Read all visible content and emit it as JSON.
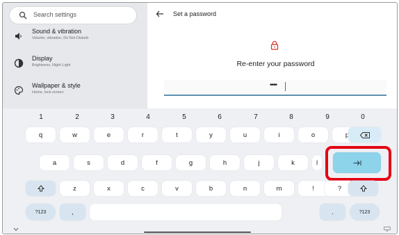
{
  "search": {
    "placeholder": "Search settings"
  },
  "settings_items": [
    {
      "title": "Sound & vibration",
      "subtitle": "Volume, vibration, Do Not Disturb",
      "icon": "speaker-icon"
    },
    {
      "title": "Display",
      "subtitle": "Brightness, Night Light",
      "icon": "brightness-icon"
    },
    {
      "title": "Wallpaper & style",
      "subtitle": "Home, lock screen",
      "icon": "palette-icon"
    }
  ],
  "password_panel": {
    "title": "Set a password",
    "prompt": "Re-enter your password",
    "masked_value": "••••",
    "icon": "lock-icon"
  },
  "keyboard": {
    "number_row": [
      "1",
      "2",
      "3",
      "4",
      "5",
      "6",
      "7",
      "8",
      "9",
      "0"
    ],
    "row1": [
      "q",
      "w",
      "e",
      "r",
      "t",
      "y",
      "u",
      "i",
      "o",
      "p"
    ],
    "row2": [
      "a",
      "s",
      "d",
      "f",
      "g",
      "h",
      "j",
      "k",
      "l"
    ],
    "row3": [
      "z",
      "x",
      "c",
      "v",
      "b",
      "n",
      "m",
      "!",
      "?"
    ],
    "symbols_label": "?123",
    "comma": ",",
    "period": ".",
    "icons": {
      "backspace": "backspace-icon",
      "enter": "next-tab-icon",
      "shift": "shift-icon"
    }
  },
  "colors": {
    "highlight": "#e60012",
    "enter_key": "#8dd3ea",
    "accent": "#1a73e8",
    "lock": "#d93025"
  }
}
